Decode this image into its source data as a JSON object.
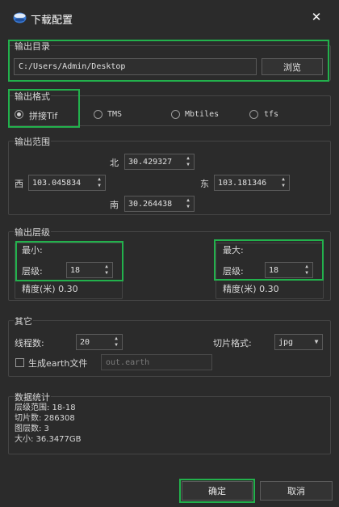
{
  "window": {
    "title": "下载配置",
    "close_icon": "close-icon"
  },
  "output_dir": {
    "group_title": "输出目录",
    "path_value": "C:/Users/Admin/Desktop",
    "browse_label": "浏览"
  },
  "output_format": {
    "group_title": "输出格式",
    "options": [
      {
        "label": "拼接Tif",
        "checked": true
      },
      {
        "label": "TMS",
        "checked": false
      },
      {
        "label": "Mbtiles",
        "checked": false
      },
      {
        "label": "tfs",
        "checked": false
      }
    ]
  },
  "output_range": {
    "group_title": "输出范围",
    "north_label": "北",
    "north_value": "30.429327",
    "west_label": "西",
    "west_value": "103.045834",
    "east_label": "东",
    "east_value": "103.181346",
    "south_label": "南",
    "south_value": "30.264438"
  },
  "output_level": {
    "group_title": "输出层级",
    "min": {
      "title": "最小:",
      "level_label": "层级:",
      "level_value": "18",
      "precision_text": "精度(米) 0.30"
    },
    "max": {
      "title": "最大:",
      "level_label": "层级:",
      "level_value": "18",
      "precision_text": "精度(米) 0.30"
    }
  },
  "other": {
    "group_title": "其它",
    "threads_label": "线程数:",
    "threads_value": "20",
    "tile_format_label": "切片格式:",
    "tile_format_value": "jpg",
    "earth_checkbox_label": "生成earth文件",
    "earth_checked": false,
    "earth_file_placeholder": "out.earth"
  },
  "stats": {
    "group_title": "数据统计",
    "lines": [
      "层级范围: 18-18",
      "切片数: 286308",
      "图层数: 3",
      "大小: 36.3477GB"
    ]
  },
  "footer": {
    "ok_label": "确定",
    "cancel_label": "取消"
  },
  "colors": {
    "background": "#2b2b2b",
    "highlight": "#22b14c",
    "text": "#d8d8d8"
  }
}
